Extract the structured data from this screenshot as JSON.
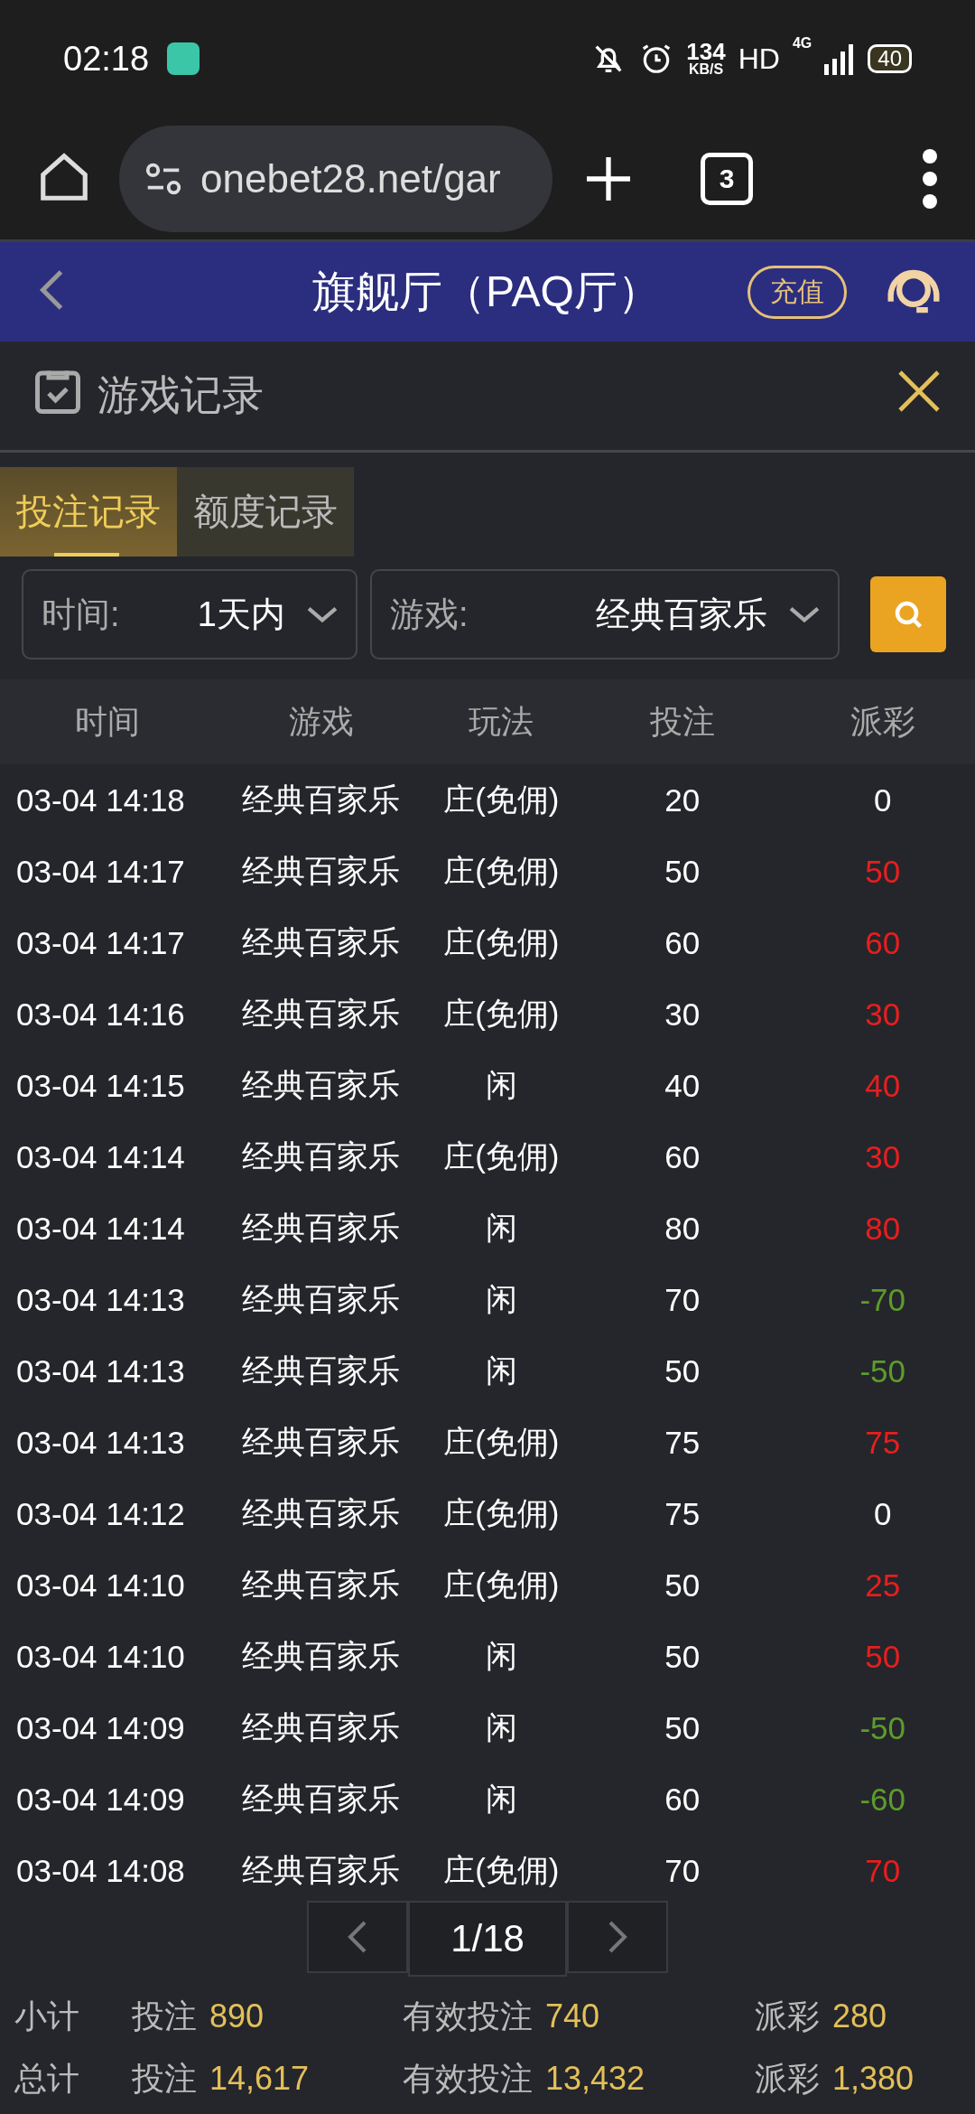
{
  "status_bar": {
    "time": "02:18",
    "speed": "134",
    "speed_unit": "KB/S",
    "hd": "HD",
    "network": "4G",
    "battery": "40"
  },
  "browser": {
    "url": "onebet28.net/gar",
    "tab_count": "3"
  },
  "header": {
    "title": "旗舰厅（PAQ厅）",
    "recharge": "充值"
  },
  "panel": {
    "title": "游戏记录"
  },
  "tabs": [
    {
      "label": "投注记录",
      "selected": true
    },
    {
      "label": "额度记录",
      "selected": false
    }
  ],
  "filters": [
    {
      "label": "时间:",
      "value": "1天内"
    },
    {
      "label": "游戏:",
      "value": "经典百家乐"
    }
  ],
  "table": {
    "columns": [
      "时间",
      "游戏",
      "玩法",
      "投注",
      "派彩"
    ],
    "rows": [
      {
        "time": "03-04 14:18",
        "game": "经典百家乐",
        "play": "庄(免佣)",
        "bet": "20",
        "payout": "0",
        "color": "#ffffff"
      },
      {
        "time": "03-04 14:17",
        "game": "经典百家乐",
        "play": "庄(免佣)",
        "bet": "50",
        "payout": "50",
        "color": "#e81e1e"
      },
      {
        "time": "03-04 14:17",
        "game": "经典百家乐",
        "play": "庄(免佣)",
        "bet": "60",
        "payout": "60",
        "color": "#e81e1e"
      },
      {
        "time": "03-04 14:16",
        "game": "经典百家乐",
        "play": "庄(免佣)",
        "bet": "30",
        "payout": "30",
        "color": "#e81e1e"
      },
      {
        "time": "03-04 14:15",
        "game": "经典百家乐",
        "play": "闲",
        "bet": "40",
        "payout": "40",
        "color": "#e81e1e"
      },
      {
        "time": "03-04 14:14",
        "game": "经典百家乐",
        "play": "庄(免佣)",
        "bet": "60",
        "payout": "30",
        "color": "#e81e1e"
      },
      {
        "time": "03-04 14:14",
        "game": "经典百家乐",
        "play": "闲",
        "bet": "80",
        "payout": "80",
        "color": "#e81e1e"
      },
      {
        "time": "03-04 14:13",
        "game": "经典百家乐",
        "play": "闲",
        "bet": "70",
        "payout": "-70",
        "color": "#5c9c2c"
      },
      {
        "time": "03-04 14:13",
        "game": "经典百家乐",
        "play": "闲",
        "bet": "50",
        "payout": "-50",
        "color": "#5c9c2c"
      },
      {
        "time": "03-04 14:13",
        "game": "经典百家乐",
        "play": "庄(免佣)",
        "bet": "75",
        "payout": "75",
        "color": "#e81e1e"
      },
      {
        "time": "03-04 14:12",
        "game": "经典百家乐",
        "play": "庄(免佣)",
        "bet": "75",
        "payout": "0",
        "color": "#ffffff"
      },
      {
        "time": "03-04 14:10",
        "game": "经典百家乐",
        "play": "庄(免佣)",
        "bet": "50",
        "payout": "25",
        "color": "#e81e1e"
      },
      {
        "time": "03-04 14:10",
        "game": "经典百家乐",
        "play": "闲",
        "bet": "50",
        "payout": "50",
        "color": "#e81e1e"
      },
      {
        "time": "03-04 14:09",
        "game": "经典百家乐",
        "play": "闲",
        "bet": "50",
        "payout": "-50",
        "color": "#5c9c2c"
      },
      {
        "time": "03-04 14:09",
        "game": "经典百家乐",
        "play": "闲",
        "bet": "60",
        "payout": "-60",
        "color": "#5c9c2c"
      },
      {
        "time": "03-04 14:08",
        "game": "经典百家乐",
        "play": "庄(免佣)",
        "bet": "70",
        "payout": "70",
        "color": "#e81e1e"
      }
    ]
  },
  "pagination": {
    "page": "1/18"
  },
  "summary": [
    {
      "label": "小计",
      "items": [
        {
          "label": "投注",
          "value": "890"
        },
        {
          "label": "有效投注",
          "value": "740"
        },
        {
          "label": "派彩",
          "value": "280"
        }
      ]
    },
    {
      "label": "总计",
      "items": [
        {
          "label": "投注",
          "value": "14,617"
        },
        {
          "label": "有效投注",
          "value": "13,432"
        },
        {
          "label": "派彩",
          "value": "1,380"
        }
      ]
    }
  ]
}
